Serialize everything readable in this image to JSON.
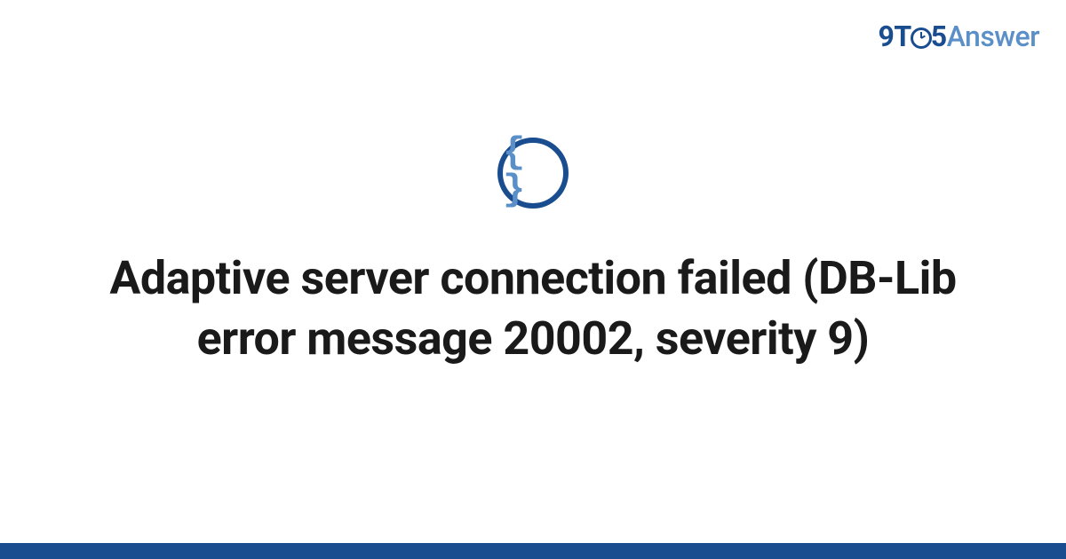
{
  "brand": {
    "part1": "9",
    "part2": "T",
    "part3_icon": "clock-icon",
    "part4": "5",
    "part5": "Answer"
  },
  "center_icon": {
    "name": "code-braces-icon",
    "glyph": "{ }"
  },
  "title": "Adaptive server connection failed (DB-Lib error message 20002, severity 9)",
  "colors": {
    "primary": "#1a4d8f",
    "secondary": "#5a8fc7",
    "text": "#1a1a1a",
    "background": "#ffffff"
  }
}
